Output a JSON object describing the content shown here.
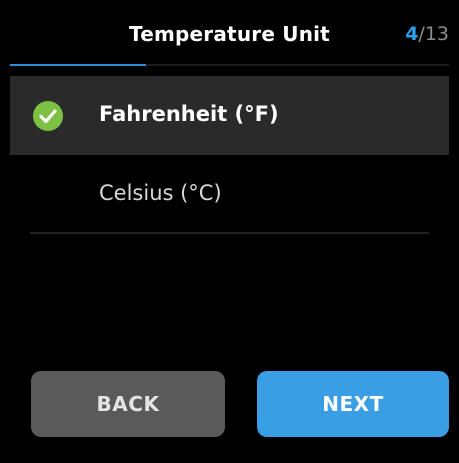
{
  "header": {
    "title": "Temperature Unit",
    "step_current": "4",
    "step_total": "/13",
    "progress_fraction": 0.31
  },
  "options": [
    {
      "label": "Fahrenheit (°F)",
      "selected": true
    },
    {
      "label": "Celsius (°C)",
      "selected": false
    }
  ],
  "buttons": {
    "back_label": "BACK",
    "next_label": "NEXT"
  },
  "colors": {
    "accent": "#2e9fea",
    "check": "#7cc144",
    "back_button": "#5a5a5a",
    "next_button": "#3a9ee5",
    "selected_row": "#2a2a2a"
  },
  "icons": {
    "selected": "checkmark-circle-icon"
  }
}
